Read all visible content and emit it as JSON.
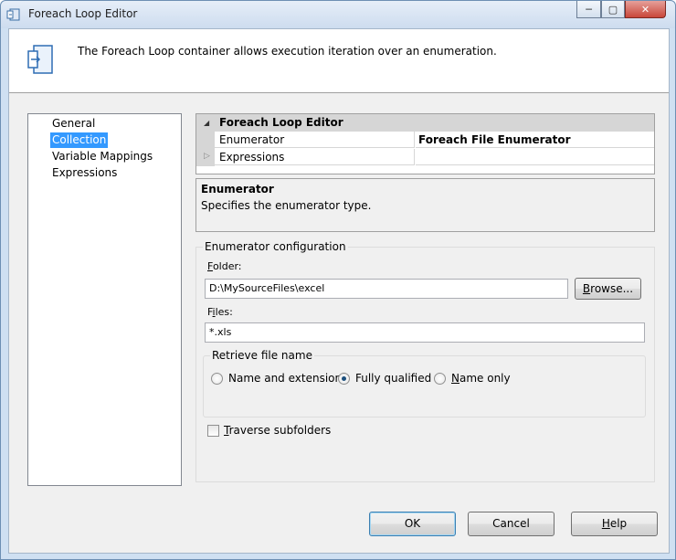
{
  "window": {
    "title": "Foreach Loop Editor",
    "controls": {
      "minimize": "─",
      "maximize": "▢",
      "close": "✕"
    }
  },
  "header": {
    "description": "The Foreach Loop container allows execution iteration over an enumeration."
  },
  "nav": {
    "items": [
      "General",
      "Collection",
      "Variable Mappings",
      "Expressions"
    ],
    "selected": "Collection"
  },
  "property_grid": {
    "category": "Foreach Loop Editor",
    "rows": [
      {
        "name": "Enumerator",
        "value": "Foreach File Enumerator"
      },
      {
        "name": "Expressions",
        "value": ""
      }
    ]
  },
  "property_description": {
    "title": "Enumerator",
    "text": "Specifies the enumerator type."
  },
  "enumerator_config": {
    "group_label": "Enumerator configuration",
    "folder_label_first": "F",
    "folder_label_rest": "older:",
    "folder_value": "D:\\MySourceFiles\\excel",
    "browse_first": "B",
    "browse_rest": "rowse...",
    "files_label_first": "F",
    "files_label_mid": "i",
    "files_label_rest": "les:",
    "files_value": "*.xls",
    "retrieve_group_label": "Retrieve file name",
    "retrieve_options": [
      {
        "label": "Name and extension",
        "selected": false
      },
      {
        "label": "Fully qualified",
        "selected": true
      },
      {
        "label_first": "N",
        "label_rest": "ame only",
        "selected": false
      }
    ],
    "traverse_first": "T",
    "traverse_rest": "raverse subfolders",
    "traverse_checked": false
  },
  "buttons": {
    "ok": "OK",
    "cancel": "Cancel",
    "help_first": "H",
    "help_rest": "elp"
  },
  "colors": {
    "selection": "#3399ff",
    "title_gradient_top": "#e6eef8",
    "close_red": "#c9473a"
  }
}
